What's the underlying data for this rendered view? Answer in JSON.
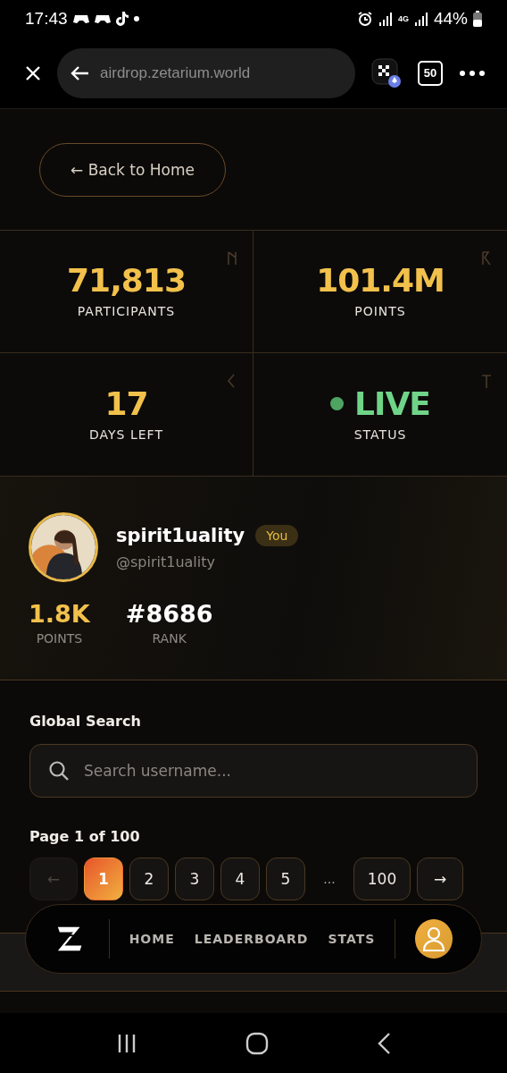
{
  "status_bar": {
    "time": "17:43",
    "network": "4G",
    "battery": "44%"
  },
  "browser": {
    "url": "airdrop.zetarium.world",
    "tab_count": "50"
  },
  "back_button": "← Back to Home",
  "stats": [
    {
      "value": "71,813",
      "label": "PARTICIPANTS",
      "kind": "number"
    },
    {
      "value": "101.4M",
      "label": "POINTS",
      "kind": "number"
    },
    {
      "value": "17",
      "label": "DAYS LEFT",
      "kind": "number"
    },
    {
      "value": "LIVE",
      "label": "STATUS",
      "kind": "status"
    }
  ],
  "profile": {
    "name": "spirit1uality",
    "badge": "You",
    "handle": "@spirit1uality",
    "stats": [
      {
        "value": "1.8K",
        "label": "POINTS",
        "kind": "points"
      },
      {
        "value": "#8686",
        "label": "RANK",
        "kind": "rank"
      }
    ]
  },
  "search": {
    "title": "Global Search",
    "placeholder": "Search username..."
  },
  "pagination": {
    "summary": "Page 1 of 100",
    "pages": [
      {
        "label": "←",
        "kind": "prev",
        "disabled": true,
        "selected": false
      },
      {
        "label": "1",
        "kind": "page",
        "disabled": false,
        "selected": true
      },
      {
        "label": "2",
        "kind": "page",
        "disabled": false,
        "selected": false
      },
      {
        "label": "3",
        "kind": "page",
        "disabled": false,
        "selected": false
      },
      {
        "label": "4",
        "kind": "page",
        "disabled": false,
        "selected": false
      },
      {
        "label": "5",
        "kind": "page",
        "disabled": false,
        "selected": false
      },
      {
        "label": "...",
        "kind": "ellipsis"
      },
      {
        "label": "100",
        "kind": "page",
        "disabled": false,
        "selected": false
      },
      {
        "label": "→",
        "kind": "next",
        "disabled": false,
        "selected": false
      }
    ]
  },
  "bottom_nav": {
    "items": [
      "HOME",
      "LEADERBOARD",
      "STATS"
    ]
  }
}
